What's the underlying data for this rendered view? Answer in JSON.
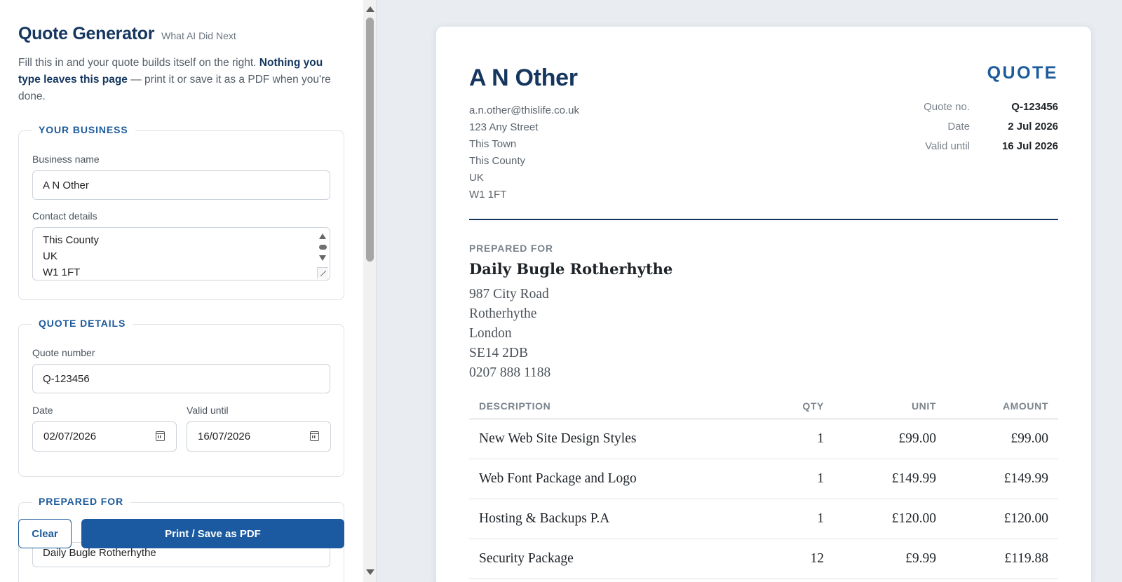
{
  "app": {
    "title": "Quote Generator",
    "subtitle": "What AI Did Next",
    "intro_plain": "Fill this in and your quote builds itself on the right. ",
    "intro_bold": "Nothing you type leaves this page",
    "intro_tail": " — print it or save it as a PDF when you're done."
  },
  "form": {
    "business": {
      "legend": "YOUR BUSINESS",
      "name_label": "Business name",
      "name_value": "A N Other",
      "contact_label": "Contact details",
      "contact_visible_lines": [
        "This County",
        "UK",
        "W1 1FT"
      ]
    },
    "quote": {
      "legend": "QUOTE DETAILS",
      "number_label": "Quote number",
      "number_value": "Q-123456",
      "date_label": "Date",
      "date_value": "02/07/2026",
      "valid_label": "Valid until",
      "valid_value": "16/07/2026"
    },
    "prepared": {
      "legend": "PREPARED FOR",
      "client_value": "Daily Bugle Rotherhythe"
    },
    "buttons": {
      "clear": "Clear",
      "print": "Print / Save as PDF"
    }
  },
  "doc": {
    "business_name": "A N Other",
    "contact_lines": [
      "a.n.other@thislife.co.uk",
      "123 Any Street",
      "This Town",
      "This County",
      "UK",
      "W1 1FT"
    ],
    "heading": "QUOTE",
    "meta": [
      {
        "label": "Quote no.",
        "value": "Q-123456"
      },
      {
        "label": "Date",
        "value": "2 Jul 2026"
      },
      {
        "label": "Valid until",
        "value": "16 Jul 2026"
      }
    ],
    "prepared_label": "PREPARED FOR",
    "client_name": "Daily Bugle Rotherhythe",
    "client_lines": [
      "987 City Road",
      "Rotherhythe",
      "London",
      "SE14 2DB",
      "0207 888 1188"
    ],
    "table": {
      "headers": {
        "desc": "DESCRIPTION",
        "qty": "QTY",
        "unit": "UNIT",
        "amount": "AMOUNT"
      },
      "rows": [
        {
          "desc": "New Web Site Design Styles",
          "qty": "1",
          "unit": "£99.00",
          "amount": "£99.00"
        },
        {
          "desc": "Web Font Package and Logo",
          "qty": "1",
          "unit": "£149.99",
          "amount": "£149.99"
        },
        {
          "desc": "Hosting & Backups P.A",
          "qty": "1",
          "unit": "£120.00",
          "amount": "£120.00"
        },
        {
          "desc": "Security Package",
          "qty": "12",
          "unit": "£9.99",
          "amount": "£119.88"
        }
      ]
    }
  }
}
